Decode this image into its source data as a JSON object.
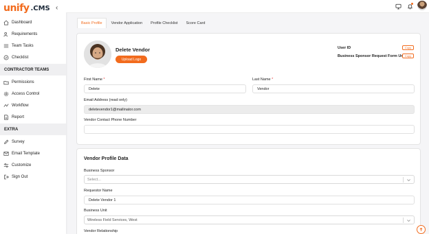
{
  "brand": {
    "logo_text": "unify",
    "suffix": ".CMS"
  },
  "sidebar": {
    "collapse_icon": "chevron-left-icon",
    "items_main": [
      {
        "label": "Dashboard",
        "icon": "home-icon"
      },
      {
        "label": "Requirements",
        "icon": "users-icon"
      },
      {
        "label": "Team Tasks",
        "icon": "tasks-icon"
      },
      {
        "label": "Checklist",
        "icon": "check-circle-icon"
      }
    ],
    "section_contractor": "CONTRACTOR TEAMS",
    "items_contractor": [
      {
        "label": "Permissions",
        "icon": "folder-icon"
      },
      {
        "label": "Access Control",
        "icon": "gear-icon"
      },
      {
        "label": "Workflow",
        "icon": "workflow-icon"
      },
      {
        "label": "Report",
        "icon": "document-icon"
      }
    ],
    "section_extra": "EXTRA",
    "items_extra": [
      {
        "label": "Survey",
        "icon": "pencil-icon"
      },
      {
        "label": "Email Template",
        "icon": "mail-icon"
      },
      {
        "label": "Customize",
        "icon": "sliders-icon"
      },
      {
        "label": "Sign Out",
        "icon": "logout-icon"
      }
    ]
  },
  "header": {
    "icons": [
      "monitor-icon",
      "bell-icon",
      "avatar"
    ]
  },
  "tabs": [
    "Basic Profile",
    "Vendor Application",
    "Profile Checklist",
    "Score Card"
  ],
  "profile": {
    "name": "Delete Vendor",
    "upload_label": "Upload Logo",
    "user_id_label": "User ID",
    "bsrf_label": "Business Sponsor Request Form Url",
    "copy_label": "Copy",
    "first_name_label": "First Name",
    "first_name": "Delete",
    "last_name_label": "Last Name",
    "last_name": "Vendor",
    "required_mark": "*",
    "email_label": "Email Address (read only)",
    "email": "deletevendor1@mailinator.com",
    "phone_label": "Vendor Contact Phone Number",
    "phone": ""
  },
  "vendor_data": {
    "title": "Vendor Profile Data",
    "sponsor_label": "Business Sponsor",
    "sponsor_placeholder": "Select...",
    "requestor_label": "Requestor Name",
    "requestor": "Delete Vendor 1",
    "unit_label": "Business Unit",
    "unit": "Wireless Field Services, West",
    "relationship_label": "Vendor Relationship"
  },
  "colors": {
    "accent": "#f26b1d",
    "navy": "#1d2a3a"
  }
}
